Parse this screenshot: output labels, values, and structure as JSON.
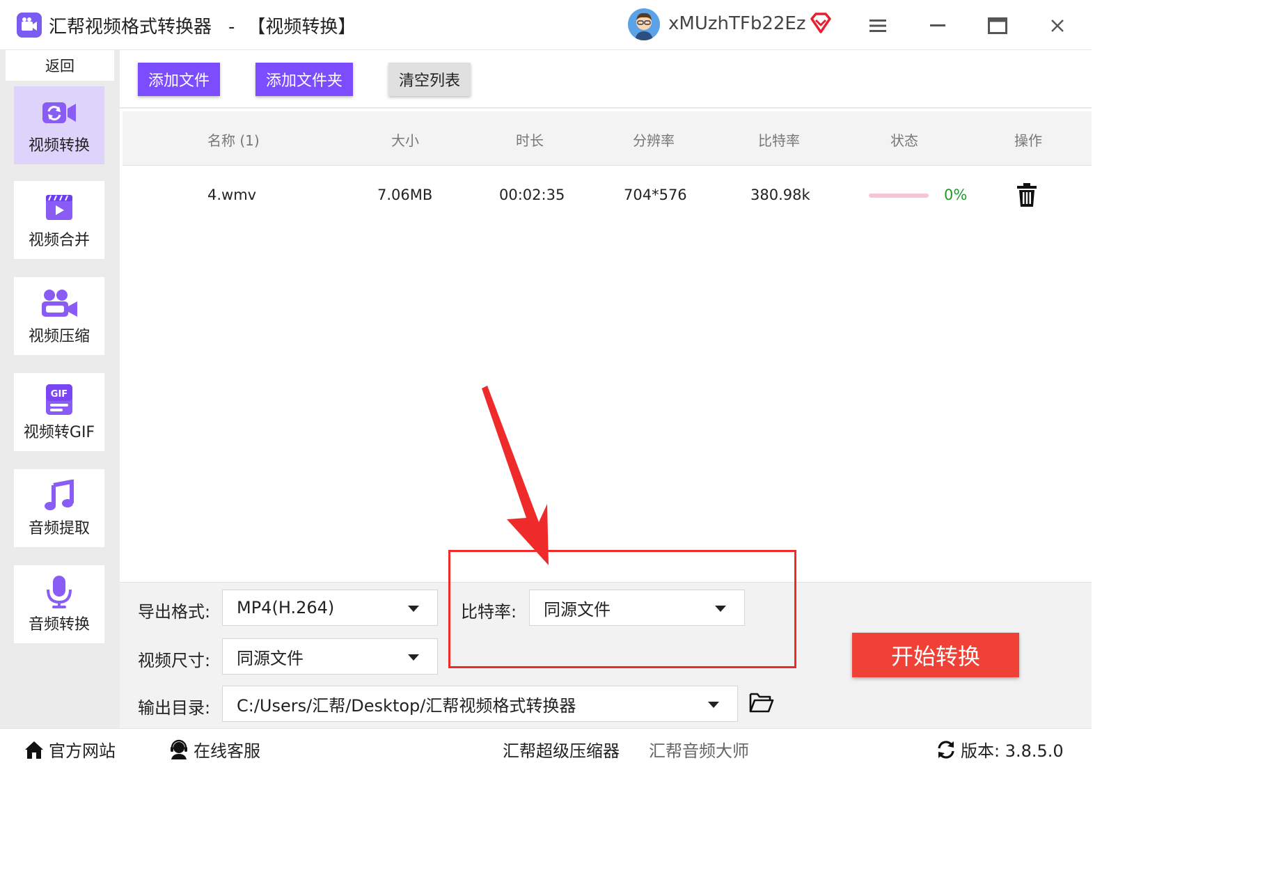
{
  "window": {
    "app_name": "汇帮视频格式转换器",
    "separator": "-",
    "section": "【视频转换】",
    "username": "xMUzhTFb22Ez"
  },
  "sidebar": {
    "back_label": "返回",
    "items": [
      {
        "label": "视频转换",
        "icon": "video-convert-icon",
        "active": true
      },
      {
        "label": "视频合并",
        "icon": "video-merge-icon",
        "active": false
      },
      {
        "label": "视频压缩",
        "icon": "video-compress-icon",
        "active": false
      },
      {
        "label": "视频转GIF",
        "icon": "gif-icon",
        "active": false
      },
      {
        "label": "音频提取",
        "icon": "music-note-icon",
        "active": false
      },
      {
        "label": "音频转换",
        "icon": "microphone-icon",
        "active": false
      }
    ]
  },
  "toolbar": {
    "add_file": "添加文件",
    "add_folder": "添加文件夹",
    "clear_list": "清空列表"
  },
  "table": {
    "headers": [
      "名称 (1)",
      "大小",
      "时长",
      "分辨率",
      "比特率",
      "状态",
      "操作"
    ],
    "rows": [
      {
        "name": "4.wmv",
        "size": "7.06MB",
        "duration": "00:02:35",
        "resolution": "704*576",
        "bitrate": "380.98k",
        "progress": 0,
        "progress_text": "0%"
      }
    ]
  },
  "settings": {
    "format_label": "导出格式:",
    "format_value": "MP4(H.264)",
    "bitrate_label": "比特率:",
    "bitrate_value": "同源文件",
    "size_label": "视频尺寸:",
    "size_value": "同源文件",
    "output_label": "输出目录:",
    "output_value": "C:/Users/汇帮/Desktop/汇帮视频格式转换器",
    "start_button": "开始转换"
  },
  "footer": {
    "website": "官方网站",
    "support": "在线客服",
    "compressor": "汇帮超级压缩器",
    "audio_master": "汇帮音频大师",
    "version": "版本:  3.8.5.0"
  },
  "colors": {
    "accent": "#7c4dff",
    "start_button": "#ef4136",
    "highlight": "#ee2a2a",
    "progress_text": "#1e9a2b"
  }
}
